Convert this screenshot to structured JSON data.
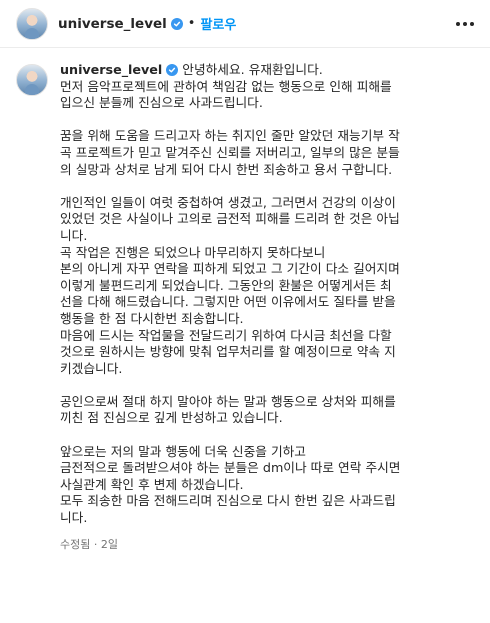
{
  "header": {
    "username": "universe_level",
    "follow_label": "팔로우"
  },
  "post": {
    "username": "universe_level",
    "first_line": "안녕하세요. 유재환입니다.",
    "lines": [
      "먼저 음악프로젝트에 관하여 책임감 없는 행동으로 인해 피해를",
      "입으신 분들께 진심으로 사과드립니다.",
      "",
      "꿈을 위해 도움을 드리고자 하는 취지인 줄만 알았던 재능기부 작",
      "곡 프로젝트가 믿고 맡겨주신 신뢰를 저버리고, 일부의 많은 분들",
      "의 실망과 상처로 남게 되어 다시 한번 죄송하고 용서 구합니다.",
      "",
      "개인적인 일들이 여럿 중첩하여 생겼고, 그러면서 건강의 이상이",
      "있었던 것은 사실이나 고의로 금전적 피해를 드리려 한 것은 아닙",
      "니다.",
      "곡 작업은 진행은 되었으나 마무리하지 못하다보니",
      "본의 아니게 자꾸 연락을 피하게 되었고 그 기간이 다소 길어지며",
      "이렇게 불편드리게 되었습니다. 그동안의 환불은 어떻게서든 최",
      "선을 다해 해드렸습니다. 그렇지만 어떤 이유에서도 질타를 받을",
      "행동을 한 점 다시한번 죄송합니다.",
      "마음에 드시는 작업물을 전달드리기 위하여 다시금 최선을 다할",
      "것으로 원하시는 방향에 맞춰 업무처리를 할 예정이므로 약속 지",
      "키겠습니다.",
      "",
      "공인으로써 절대 하지 말아야 하는 말과 행동으로 상처와 피해를",
      "끼친 점 진심으로 깊게 반성하고 있습니다.",
      "",
      "앞으로는 저의 말과 행동에 더욱 신중을 기하고",
      "금전적으로 돌려받으셔야 하는 분들은 dm이나 따로 연락 주시면",
      "사실관계 확인 후 변제 하겠습니다.",
      "모두 죄송한 마음 전해드리며 진심으로 다시 한번 깊은 사과드립",
      "니다."
    ],
    "edited_label": "수정됨",
    "separator": "·",
    "time_ago": "2일"
  },
  "colors": {
    "verified": "#3897f0",
    "follow": "#0095f6",
    "meta": "#737373"
  },
  "icons": [
    "verified-badge-icon",
    "more-options-icon"
  ]
}
